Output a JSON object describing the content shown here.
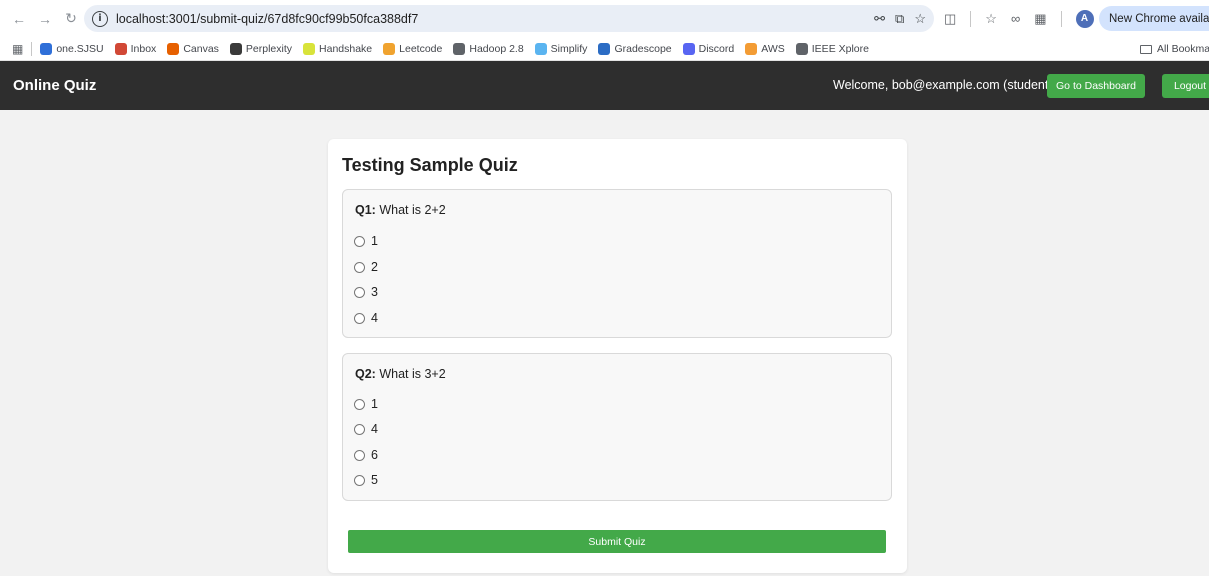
{
  "browser": {
    "url": "localhost:3001/submit-quiz/67d8fc90cf99b50fca388df7",
    "update_pill": "New Chrome available",
    "profile_initial": "A",
    "bookmarks": [
      {
        "label": "one.SJSU",
        "icon": "sjsu-icon",
        "color": "#2f6fd8"
      },
      {
        "label": "Inbox",
        "icon": "gmail-icon",
        "color": "#d14836"
      },
      {
        "label": "Canvas",
        "icon": "canvas-icon",
        "color": "#e66000"
      },
      {
        "label": "Perplexity",
        "icon": "perplexity-icon",
        "color": "#3a3a3a"
      },
      {
        "label": "Handshake",
        "icon": "handshake-icon",
        "color": "#d8e33a"
      },
      {
        "label": "Leetcode",
        "icon": "leetcode-icon",
        "color": "#f0a32f"
      },
      {
        "label": "Hadoop 2.8",
        "icon": "globe-icon",
        "color": "#5f6368"
      },
      {
        "label": "Simplify",
        "icon": "simplify-icon",
        "color": "#5ab4f0"
      },
      {
        "label": "Gradescope",
        "icon": "gradescope-icon",
        "color": "#2b6cc4"
      },
      {
        "label": "Discord",
        "icon": "discord-icon",
        "color": "#5865f2"
      },
      {
        "label": "AWS",
        "icon": "aws-icon",
        "color": "#f39c34"
      },
      {
        "label": "IEEE Xplore",
        "icon": "globe-icon",
        "color": "#5f6368"
      }
    ],
    "all_bookmarks": "All Bookmarks"
  },
  "navbar": {
    "brand": "Online Quiz",
    "welcome": "Welcome, bob@example.com (student)",
    "dashboard_label": "Go to Dashboard",
    "logout_label": "Logout"
  },
  "quiz": {
    "title": "Testing Sample Quiz",
    "questions": [
      {
        "label": "Q1:",
        "text": "What is 2+2",
        "options": [
          "1",
          "2",
          "3",
          "4"
        ]
      },
      {
        "label": "Q2:",
        "text": "What is 3+2",
        "options": [
          "1",
          "4",
          "6",
          "5"
        ]
      }
    ],
    "submit_label": "Submit Quiz"
  },
  "colors": {
    "navbar_bg": "#2e2e2e",
    "accent_green": "#43a949",
    "page_bg": "#f2f2f2"
  }
}
